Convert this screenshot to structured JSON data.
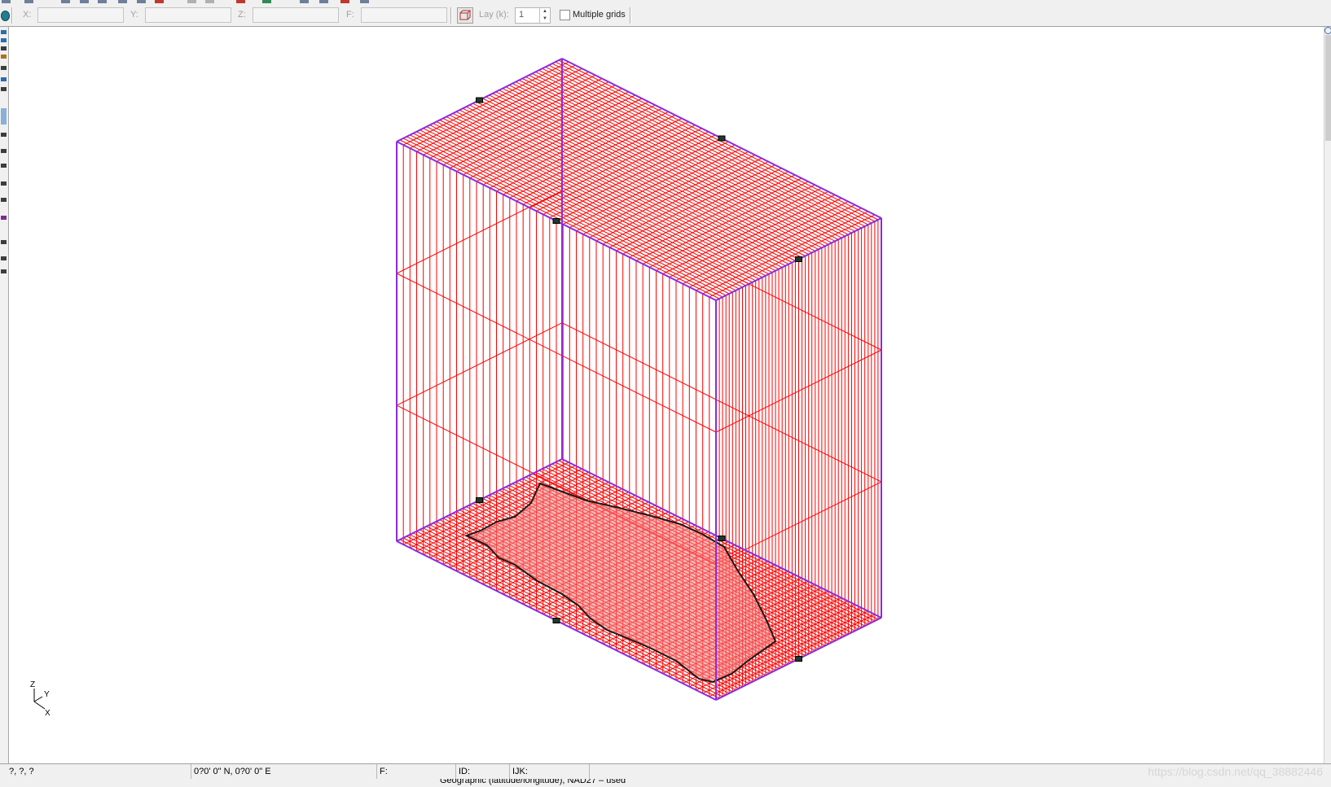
{
  "coord_toolbar": {
    "x_label": "X:",
    "y_label": "Y:",
    "z_label": "Z:",
    "f_label": "F:",
    "x_value": "",
    "y_value": "",
    "z_value": "",
    "f_value": "",
    "layer_label": "Lay (k):",
    "layer_value": "1",
    "multiple_grids_label": "Multiple grids",
    "multiple_grids_checked": false
  },
  "viewport": {
    "grid_color": "#ff0000",
    "boundary_color": "#8a2be2",
    "axis_triad": {
      "z_label": "Z",
      "y_label": "Y",
      "x_label": "X"
    }
  },
  "status_bar": {
    "ijk_position": "?, ?, ?",
    "latlon": "0?0' 0\" N, 0?0' 0\" E",
    "f_label": "F:",
    "id_label": "ID:",
    "ijk_label": "IJK:"
  },
  "watermark": "https://blog.csdn.net/qq_38882446",
  "coordinate_system_text": "Geographic (latitude/longitude), NAD27 – used"
}
